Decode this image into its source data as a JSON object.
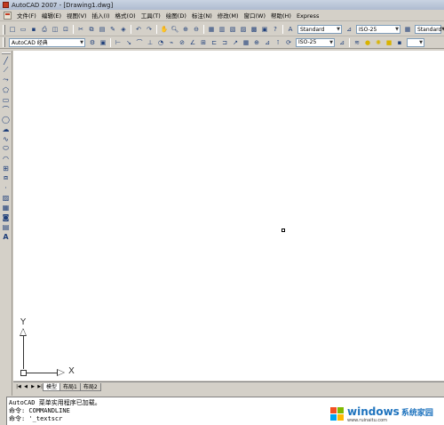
{
  "window": {
    "title": "AutoCAD 2007 - [Drawing1.dwg]"
  },
  "menu": {
    "items": [
      "文件(F)",
      "编辑(E)",
      "视图(V)",
      "插入(I)",
      "格式(O)",
      "工具(T)",
      "绘图(D)",
      "标注(N)",
      "修改(M)",
      "窗口(W)",
      "帮助(H)",
      "Express"
    ]
  },
  "toolbar1": {
    "text_style": "Standard",
    "dim_style": "ISO-25",
    "table_style": "Standard"
  },
  "toolbar2": {
    "workspace": "AutoCAD 经典",
    "dim_style_2": "ISO-25"
  },
  "ucs": {
    "x_label": "X",
    "y_label": "Y"
  },
  "layout_tabs": {
    "model": "模型",
    "layout1": "布局1",
    "layout2": "布局2"
  },
  "command_line": {
    "lines": [
      "AutoCAD 菜单实用程序已加载。",
      "命令: COMMANDLINE",
      "命令: '_textscr"
    ]
  },
  "watermark": {
    "brand": "windows",
    "cn": "系统家园",
    "url": "www.ruinaitu.com"
  },
  "colors": {
    "accent": "#1e73be",
    "canvas": "#ffffff",
    "chrome": "#d4d0c8"
  }
}
